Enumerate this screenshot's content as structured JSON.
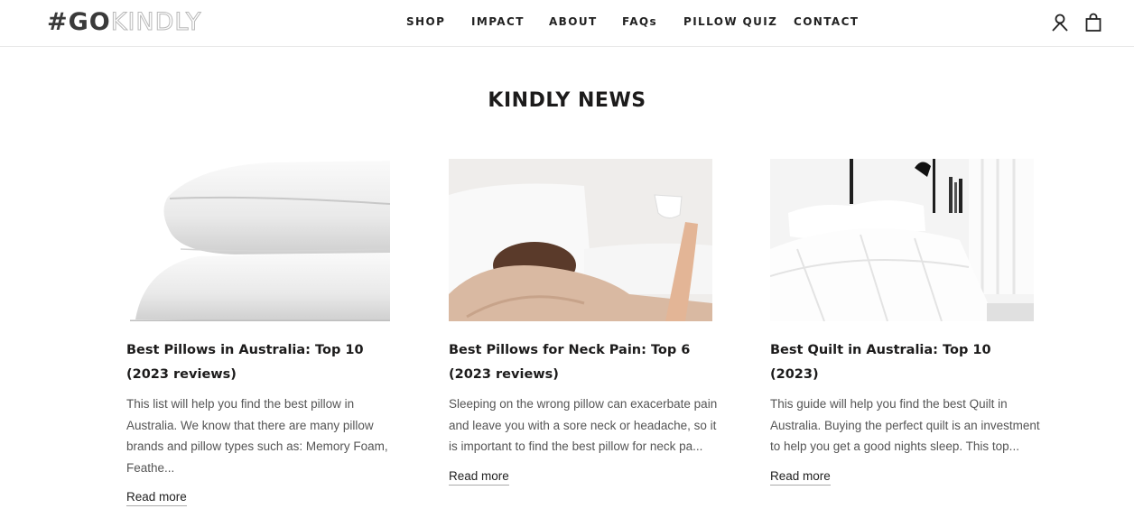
{
  "header": {
    "logo_bold": "#GO",
    "logo_light": "KINDLY",
    "nav": [
      "SHOP",
      "IMPACT",
      "ABOUT",
      "FAQs",
      "PILLOW QUIZ",
      "CONTACT"
    ]
  },
  "main": {
    "title": "KINDLY NEWS",
    "articles": [
      {
        "title": "Best Pillows in Australia: Top 10 (2023 reviews)",
        "excerpt": "This list will help you find the best pillow in Australia.  We know that there are many pillow brands and pillow types such as: Memory Foam, Feathe...",
        "read_more": "Read more"
      },
      {
        "title": "Best Pillows for Neck Pain: Top 6 (2023 reviews)",
        "excerpt": "Sleeping on the wrong pillow can exacerbate pain and leave you with a sore neck or headache, so it is important to find the best pillow for neck pa...",
        "read_more": "Read more"
      },
      {
        "title": "Best Quilt in Australia: Top 10 (2023)",
        "excerpt": "This guide will help you find the best Quilt in Australia. Buying the perfect quilt is an investment to help you get a good nights sleep. This top...",
        "read_more": "Read more"
      }
    ]
  },
  "icons": {
    "account": "user-icon",
    "cart": "shopping-bag-icon"
  }
}
